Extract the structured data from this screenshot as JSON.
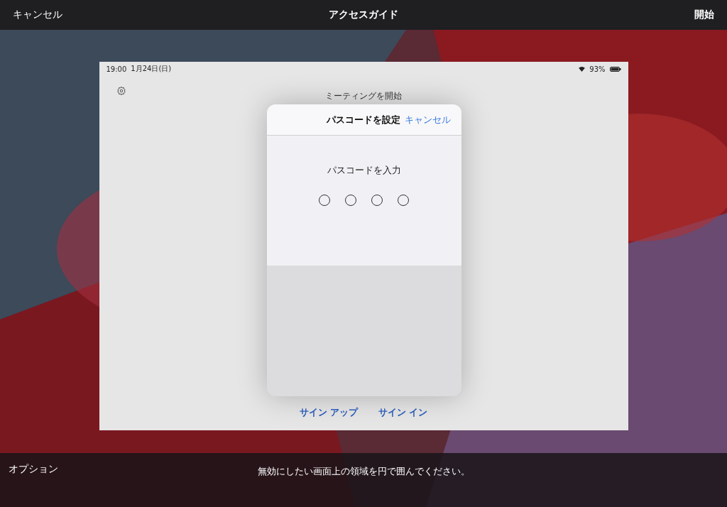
{
  "top_bar": {
    "left_button": "キャンセル",
    "title": "アクセスガイド",
    "right_button": "開始"
  },
  "preview": {
    "status_bar": {
      "time": "19:00",
      "date": "1月24日(日)",
      "battery": "93%"
    },
    "heading": "ミーティングを開始",
    "links": [
      "サイン アップ",
      "サイン イン"
    ],
    "sheet": {
      "title": "パスコードを設定",
      "cancel": "キャンセル",
      "prompt": "パスコードを入力",
      "digits": [
        {
          "filled": false
        },
        {
          "filled": false
        },
        {
          "filled": false
        },
        {
          "filled": false
        }
      ]
    }
  },
  "bottom_bar": {
    "options": "オプション",
    "hint": "無効にしたい画面上の領域を円で囲んでください。"
  }
}
